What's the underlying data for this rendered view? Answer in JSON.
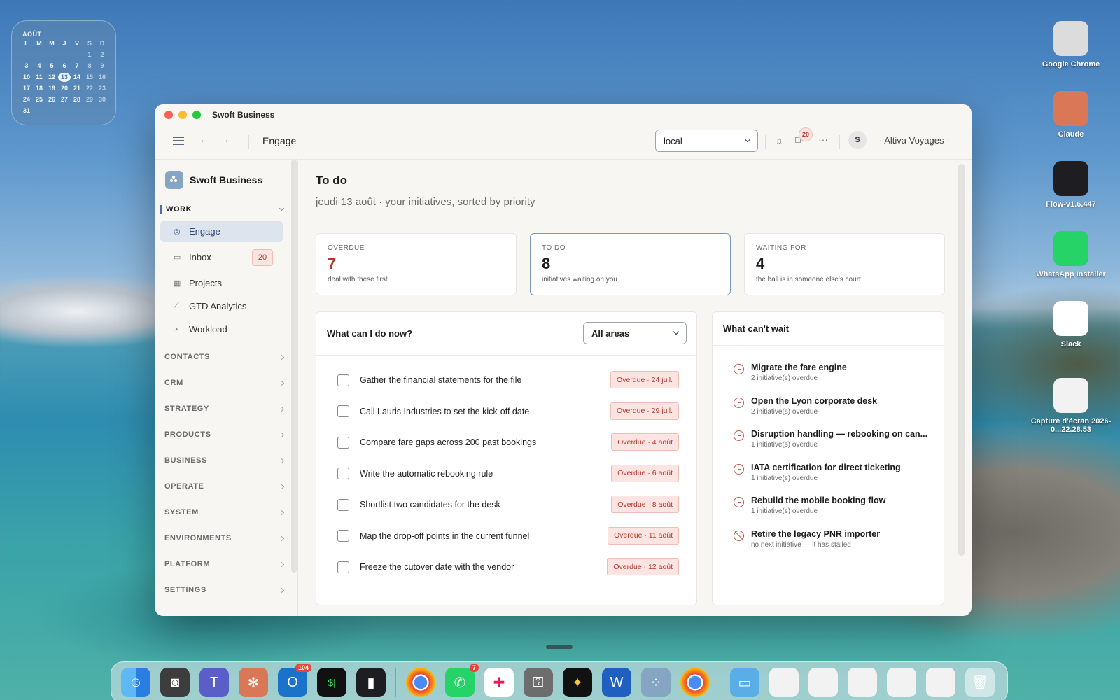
{
  "desktop": {
    "calendar": {
      "month": "AOÛT",
      "weekdays": [
        "L",
        "M",
        "M",
        "J",
        "V",
        "S",
        "D"
      ],
      "rows": [
        [
          "",
          "",
          "",
          "",
          "",
          "1",
          "2"
        ],
        [
          "3",
          "4",
          "5",
          "6",
          "7",
          "8",
          "9"
        ],
        [
          "10",
          "11",
          "12",
          "13",
          "14",
          "15",
          "16"
        ],
        [
          "17",
          "18",
          "19",
          "20",
          "21",
          "22",
          "23"
        ],
        [
          "24",
          "25",
          "26",
          "27",
          "28",
          "29",
          "30"
        ],
        [
          "31",
          "",
          "",
          "",
          "",
          "",
          ""
        ]
      ],
      "today": "13"
    },
    "icons": [
      {
        "label": "Google Chrome",
        "icon": "chrome-icon",
        "color": "#dcdcdc"
      },
      {
        "label": "Claude",
        "icon": "claude-icon",
        "color": "#d97757"
      },
      {
        "label": "Flow-v1.6.447",
        "icon": "flow-icon",
        "color": "#1e1e22"
      },
      {
        "label": "WhatsApp Installer",
        "icon": "whatsapp-icon",
        "color": "#25d366"
      },
      {
        "label": "Slack",
        "icon": "slack-icon",
        "color": "#ffffff"
      },
      {
        "label": "Capture d'écran 2026-0...22.28.53",
        "icon": "screenshot-file-icon",
        "color": "#f2f2f2"
      }
    ],
    "dock_badges": {
      "outlook": "104",
      "whatsapp": "7"
    }
  },
  "window": {
    "title": "Swoft Business",
    "toolbar": {
      "page_title": "Engage",
      "environment": "local",
      "notifications": "20",
      "more": "···",
      "avatar": "S",
      "org": "· Altiva Voyages ·"
    },
    "sidebar": {
      "brand": "Swoft Business",
      "work_label": "WORK",
      "items": [
        {
          "label": "Engage",
          "icon": "target-icon",
          "active": true
        },
        {
          "label": "Inbox",
          "icon": "inbox-icon",
          "badge": "20"
        },
        {
          "label": "Projects",
          "icon": "projects-icon"
        },
        {
          "label": "GTD Analytics",
          "icon": "chart-icon"
        },
        {
          "label": "Workload",
          "icon": "gauge-icon"
        }
      ],
      "sections": [
        "CONTACTS",
        "CRM",
        "STRATEGY",
        "PRODUCTS",
        "BUSINESS",
        "OPERATE",
        "SYSTEM",
        "ENVIRONMENTS",
        "PLATFORM",
        "SETTINGS"
      ]
    },
    "main": {
      "title": "To do",
      "subtitle": "jeudi 13 août · your initiatives, sorted by priority",
      "stats": [
        {
          "label": "OVERDUE",
          "value": "7",
          "desc": "deal with these first"
        },
        {
          "label": "TO DO",
          "value": "8",
          "desc": "initiatives waiting on you"
        },
        {
          "label": "WAITING FOR",
          "value": "4",
          "desc": "the ball is in someone else's court"
        }
      ],
      "now_panel": {
        "title": "What can I do now?",
        "filter": "All areas",
        "tasks": [
          {
            "label": "Gather the financial statements for the file",
            "due": "Overdue · 24 juil."
          },
          {
            "label": "Call Lauris Industries to set the kick-off date",
            "due": "Overdue · 29 juil."
          },
          {
            "label": "Compare fare gaps across 200 past bookings",
            "due": "Overdue · 4 août"
          },
          {
            "label": "Write the automatic rebooking rule",
            "due": "Overdue · 6 août"
          },
          {
            "label": "Shortlist two candidates for the desk",
            "due": "Overdue · 8 août"
          },
          {
            "label": "Map the drop-off points in the current funnel",
            "due": "Overdue · 11 août"
          },
          {
            "label": "Freeze the cutover date with the vendor",
            "due": "Overdue · 12 août"
          }
        ]
      },
      "urgent_panel": {
        "title": "What can't wait",
        "items": [
          {
            "title": "Migrate the fare engine",
            "sub": "2 initiative(s) overdue",
            "icon": "alarm-icon"
          },
          {
            "title": "Open the Lyon corporate desk",
            "sub": "2 initiative(s) overdue",
            "icon": "alarm-icon"
          },
          {
            "title": "Disruption handling — rebooking on can...",
            "sub": "1 initiative(s) overdue",
            "icon": "alarm-icon"
          },
          {
            "title": "IATA certification for direct ticketing",
            "sub": "1 initiative(s) overdue",
            "icon": "alarm-icon"
          },
          {
            "title": "Rebuild the mobile booking flow",
            "sub": "1 initiative(s) overdue",
            "icon": "alarm-icon"
          },
          {
            "title": "Retire the legacy PNR importer",
            "sub": "no next initiative — it has stalled",
            "icon": "stalled-icon"
          }
        ]
      }
    }
  }
}
